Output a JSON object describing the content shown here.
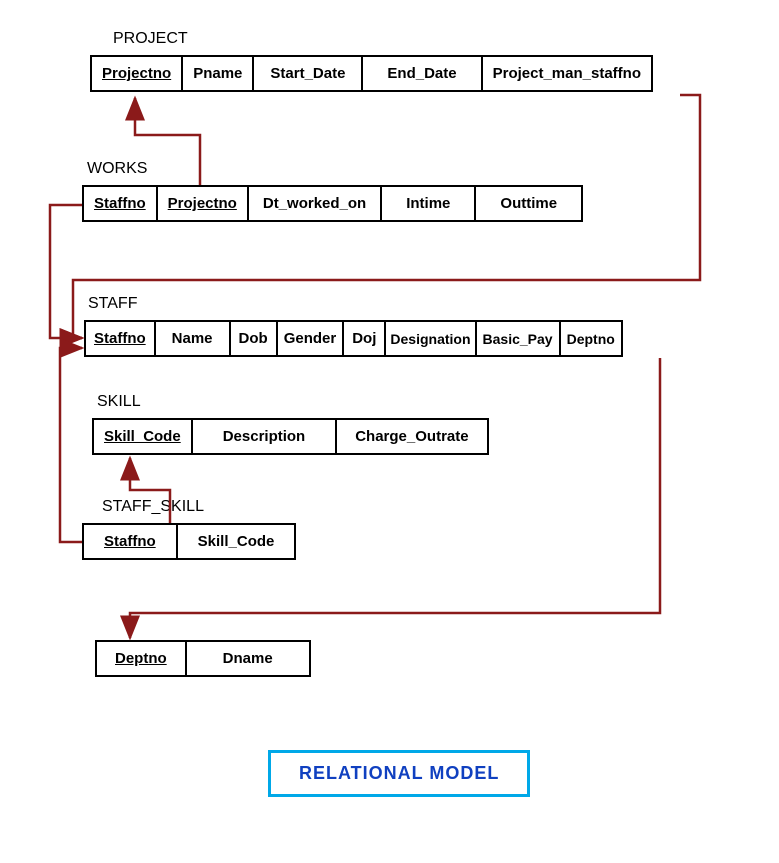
{
  "tables": {
    "project": {
      "name": "PROJECT",
      "columns": [
        "Projectno",
        "Pname",
        "Start_Date",
        "End_Date",
        "Project_man_staffno"
      ],
      "keys": [
        true,
        false,
        false,
        false,
        false
      ]
    },
    "works": {
      "name": "WORKS",
      "columns": [
        "Staffno",
        "Projectno",
        "Dt_worked_on",
        "Intime",
        "Outtime"
      ],
      "keys": [
        true,
        true,
        false,
        false,
        false
      ]
    },
    "staff": {
      "name": "STAFF",
      "columns": [
        "Staffno",
        "Name",
        "Dob",
        "Gender",
        "Doj",
        "Designation",
        "Basic_Pay",
        "Deptno"
      ],
      "keys": [
        true,
        false,
        false,
        false,
        false,
        false,
        false,
        false
      ]
    },
    "skill": {
      "name": "SKILL",
      "columns": [
        "Skill_Code",
        "Description",
        "Charge_Outrate"
      ],
      "keys": [
        true,
        false,
        false
      ]
    },
    "staff_skill": {
      "name": "STAFF_SKILL",
      "columns": [
        "Staffno",
        "Skill_Code"
      ],
      "keys": [
        true,
        false
      ]
    },
    "dept": {
      "name": "",
      "columns": [
        "Deptno",
        "Dname"
      ],
      "keys": [
        true,
        false
      ]
    }
  },
  "footer": "RELATIONAL MODEL",
  "arrow_color": "#8b1a1a"
}
